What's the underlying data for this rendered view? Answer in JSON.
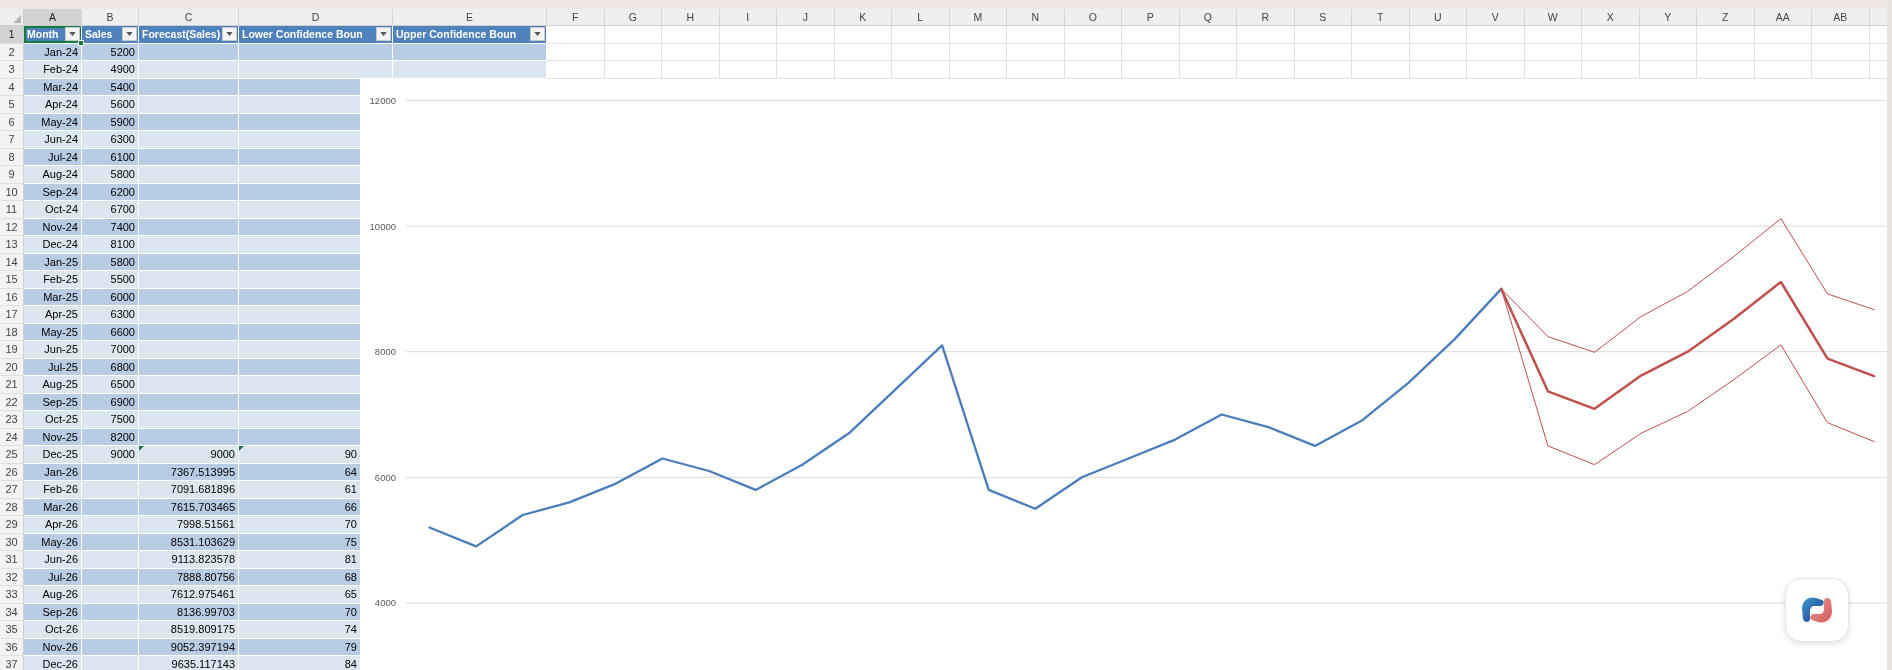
{
  "column_headers": [
    {
      "label": "A",
      "selected": true
    },
    {
      "label": "B",
      "selected": false
    },
    {
      "label": "C",
      "selected": false
    },
    {
      "label": "D",
      "selected": false
    },
    {
      "label": "E",
      "selected": false
    },
    {
      "label": "F",
      "selected": false
    },
    {
      "label": "G",
      "selected": false
    },
    {
      "label": "H",
      "selected": false
    },
    {
      "label": "I",
      "selected": false
    },
    {
      "label": "J",
      "selected": false
    },
    {
      "label": "K",
      "selected": false
    },
    {
      "label": "L",
      "selected": false
    },
    {
      "label": "M",
      "selected": false
    },
    {
      "label": "N",
      "selected": false
    },
    {
      "label": "O",
      "selected": false
    },
    {
      "label": "P",
      "selected": false
    },
    {
      "label": "Q",
      "selected": false
    },
    {
      "label": "R",
      "selected": false
    },
    {
      "label": "S",
      "selected": false
    },
    {
      "label": "T",
      "selected": false
    },
    {
      "label": "U",
      "selected": false
    },
    {
      "label": "V",
      "selected": false
    },
    {
      "label": "W",
      "selected": false
    },
    {
      "label": "X",
      "selected": false
    },
    {
      "label": "Y",
      "selected": false
    },
    {
      "label": "Z",
      "selected": false
    },
    {
      "label": "AA",
      "selected": false
    },
    {
      "label": "AB",
      "selected": false
    }
  ],
  "table": {
    "header": {
      "number": "1",
      "selected": true,
      "columns": [
        {
          "label": "Month",
          "selected": true
        },
        {
          "label": "Sales",
          "selected": false
        },
        {
          "label": "Forecast(Sales)",
          "selected": false
        },
        {
          "label": "Lower Confidence Boun",
          "selected": false
        },
        {
          "label": "Upper Confidence Boun",
          "selected": false
        }
      ]
    },
    "rows": [
      {
        "number": "2",
        "selected": false,
        "flagged": false,
        "month": "Jan-24",
        "sales": "5200"
      },
      {
        "number": "3",
        "selected": false,
        "flagged": false,
        "month": "Feb-24",
        "sales": "4900"
      },
      {
        "number": "4",
        "selected": false,
        "flagged": false,
        "month": "Mar-24",
        "sales": "5400"
      },
      {
        "number": "5",
        "selected": false,
        "flagged": false,
        "month": "Apr-24",
        "sales": "5600"
      },
      {
        "number": "6",
        "selected": false,
        "flagged": false,
        "month": "May-24",
        "sales": "5900"
      },
      {
        "number": "7",
        "selected": false,
        "flagged": false,
        "month": "Jun-24",
        "sales": "6300"
      },
      {
        "number": "8",
        "selected": false,
        "flagged": false,
        "month": "Jul-24",
        "sales": "6100"
      },
      {
        "number": "9",
        "selected": false,
        "flagged": false,
        "month": "Aug-24",
        "sales": "5800"
      },
      {
        "number": "10",
        "selected": false,
        "flagged": false,
        "month": "Sep-24",
        "sales": "6200"
      },
      {
        "number": "11",
        "selected": false,
        "flagged": false,
        "month": "Oct-24",
        "sales": "6700"
      },
      {
        "number": "12",
        "selected": false,
        "flagged": false,
        "month": "Nov-24",
        "sales": "7400"
      },
      {
        "number": "13",
        "selected": false,
        "flagged": false,
        "month": "Dec-24",
        "sales": "8100"
      },
      {
        "number": "14",
        "selected": false,
        "flagged": false,
        "month": "Jan-25",
        "sales": "5800"
      },
      {
        "number": "15",
        "selected": false,
        "flagged": false,
        "month": "Feb-25",
        "sales": "5500"
      },
      {
        "number": "16",
        "selected": false,
        "flagged": false,
        "month": "Mar-25",
        "sales": "6000"
      },
      {
        "number": "17",
        "selected": false,
        "flagged": false,
        "month": "Apr-25",
        "sales": "6300"
      },
      {
        "number": "18",
        "selected": false,
        "flagged": false,
        "month": "May-25",
        "sales": "6600"
      },
      {
        "number": "19",
        "selected": false,
        "flagged": false,
        "month": "Jun-25",
        "sales": "7000"
      },
      {
        "number": "20",
        "selected": false,
        "flagged": false,
        "month": "Jul-25",
        "sales": "6800"
      },
      {
        "number": "21",
        "selected": false,
        "flagged": false,
        "month": "Aug-25",
        "sales": "6500"
      },
      {
        "number": "22",
        "selected": false,
        "flagged": false,
        "month": "Sep-25",
        "sales": "6900"
      },
      {
        "number": "23",
        "selected": false,
        "flagged": false,
        "month": "Oct-25",
        "sales": "7500"
      },
      {
        "number": "24",
        "selected": false,
        "flagged": false,
        "month": "Nov-25",
        "sales": "8200"
      },
      {
        "number": "25",
        "selected": false,
        "flagged": true,
        "month": "Dec-25",
        "sales": "9000",
        "forecast_sales": "9000",
        "lower_confidence_bound": "90"
      },
      {
        "number": "26",
        "selected": false,
        "flagged": false,
        "month": "Jan-26",
        "forecast_sales": "7367.513995",
        "lower_confidence_bound": "64"
      },
      {
        "number": "27",
        "selected": false,
        "flagged": false,
        "month": "Feb-26",
        "forecast_sales": "7091.681896",
        "lower_confidence_bound": "61"
      },
      {
        "number": "28",
        "selected": false,
        "flagged": false,
        "month": "Mar-26",
        "forecast_sales": "7615.703465",
        "lower_confidence_bound": "66"
      },
      {
        "number": "29",
        "selected": false,
        "flagged": false,
        "month": "Apr-26",
        "forecast_sales": "7998.51561",
        "lower_confidence_bound": "70"
      },
      {
        "number": "30",
        "selected": false,
        "flagged": false,
        "month": "May-26",
        "forecast_sales": "8531.103629",
        "lower_confidence_bound": "75"
      },
      {
        "number": "31",
        "selected": false,
        "flagged": false,
        "month": "Jun-26",
        "forecast_sales": "9113.823578",
        "lower_confidence_bound": "81"
      },
      {
        "number": "32",
        "selected": false,
        "flagged": false,
        "month": "Jul-26",
        "forecast_sales": "7888.80756",
        "lower_confidence_bound": "68"
      },
      {
        "number": "33",
        "selected": false,
        "flagged": false,
        "month": "Aug-26",
        "forecast_sales": "7612.975461",
        "lower_confidence_bound": "65"
      },
      {
        "number": "34",
        "selected": false,
        "flagged": false,
        "month": "Sep-26",
        "forecast_sales": "8136.99703",
        "lower_confidence_bound": "70"
      },
      {
        "number": "35",
        "selected": false,
        "flagged": false,
        "month": "Oct-26",
        "forecast_sales": "8519.809175",
        "lower_confidence_bound": "74"
      },
      {
        "number": "36",
        "selected": false,
        "flagged": false,
        "month": "Nov-26",
        "forecast_sales": "9052.397194",
        "lower_confidence_bound": "79"
      },
      {
        "number": "37",
        "selected": false,
        "flagged": false,
        "month": "Dec-26",
        "forecast_sales": "9635.117143",
        "lower_confidence_bound": "84"
      }
    ]
  },
  "chart": {
    "chart_data": {
      "type": "line",
      "ylim": [
        4000,
        12000
      ],
      "yticks": [
        4000,
        6000,
        8000,
        10000,
        12000
      ],
      "grid": true,
      "series": [
        {
          "color": "#4a7ebb",
          "values": [
            5200,
            4900,
            5400,
            5600,
            5900,
            6300,
            6100,
            5800,
            6200,
            6700,
            7400,
            8100,
            5800,
            5500,
            6000,
            6300,
            6600,
            7000,
            6800,
            6500,
            6900,
            7500,
            8200,
            9000,
            null,
            null,
            null,
            null,
            null,
            null,
            null,
            null
          ]
        },
        {
          "color": "#c0504d",
          "values": [
            null,
            null,
            null,
            null,
            null,
            null,
            null,
            null,
            null,
            null,
            null,
            null,
            null,
            null,
            null,
            null,
            null,
            null,
            null,
            null,
            null,
            null,
            null,
            9000,
            7370,
            7090,
            7620,
            8000,
            8530,
            9110,
            7890,
            7610
          ]
        },
        {
          "color": "#c0504d",
          "values": [
            null,
            null,
            null,
            null,
            null,
            null,
            null,
            null,
            null,
            null,
            null,
            null,
            null,
            null,
            null,
            null,
            null,
            null,
            null,
            null,
            null,
            null,
            null,
            9000,
            6500,
            6200,
            6700,
            7050,
            7560,
            8110,
            6870,
            6570
          ]
        },
        {
          "color": "#c0504d",
          "values": [
            null,
            null,
            null,
            null,
            null,
            null,
            null,
            null,
            null,
            null,
            null,
            null,
            null,
            null,
            null,
            null,
            null,
            null,
            null,
            null,
            null,
            null,
            null,
            9000,
            8240,
            7990,
            8560,
            8960,
            9520,
            10120,
            8920,
            8670
          ]
        }
      ]
    }
  }
}
